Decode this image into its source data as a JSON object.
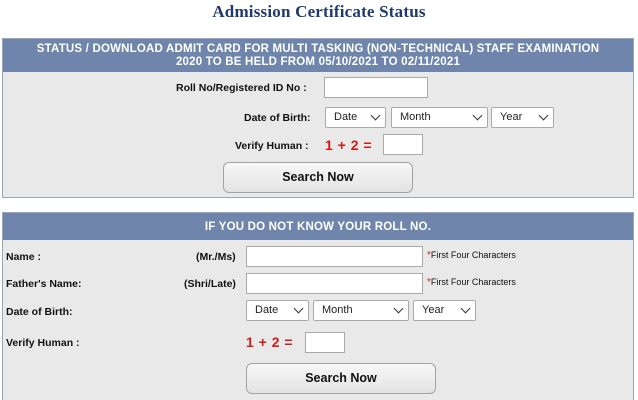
{
  "page": {
    "title": "Admission Certificate Status"
  },
  "status_panel": {
    "header_line1": "STATUS / DOWNLOAD ADMIT CARD FOR MULTI TASKING (NON-TECHNICAL) STAFF EXAMINATION",
    "header_line2": "2020 TO BE HELD FROM 05/10/2021 TO 02/11/2021",
    "roll_label": "Roll No/Registered ID No :",
    "roll_value": "",
    "dob_label": "Date of Birth:",
    "dob_date": "Date",
    "dob_month": "Month",
    "dob_year": "Year",
    "verify_label": "Verify Human :",
    "captcha": "1 + 2 =",
    "captcha_answer": "",
    "search_label": "Search Now"
  },
  "roll_lookup_panel": {
    "header": "IF YOU DO NOT KNOW YOUR ROLL NO.",
    "name_label": "Name :",
    "name_prefix": "(Mr./Ms)",
    "name_value": "",
    "name_hint": "First Four Characters",
    "father_label": "Father's Name:",
    "father_prefix": "(Shri/Late)",
    "father_value": "",
    "father_hint": "First Four Characters",
    "dob_label": "Date of Birth:",
    "dob_date": "Date",
    "dob_month": "Month",
    "dob_year": "Year",
    "verify_label": "Verify Human :",
    "captcha": "1 + 2 =",
    "captcha_answer": "",
    "search_label": "Search Now",
    "required_mark": "*"
  },
  "colors": {
    "header_bg": "#6f85ac",
    "title": "#1f3a6e",
    "captcha": "#d11a1a"
  }
}
